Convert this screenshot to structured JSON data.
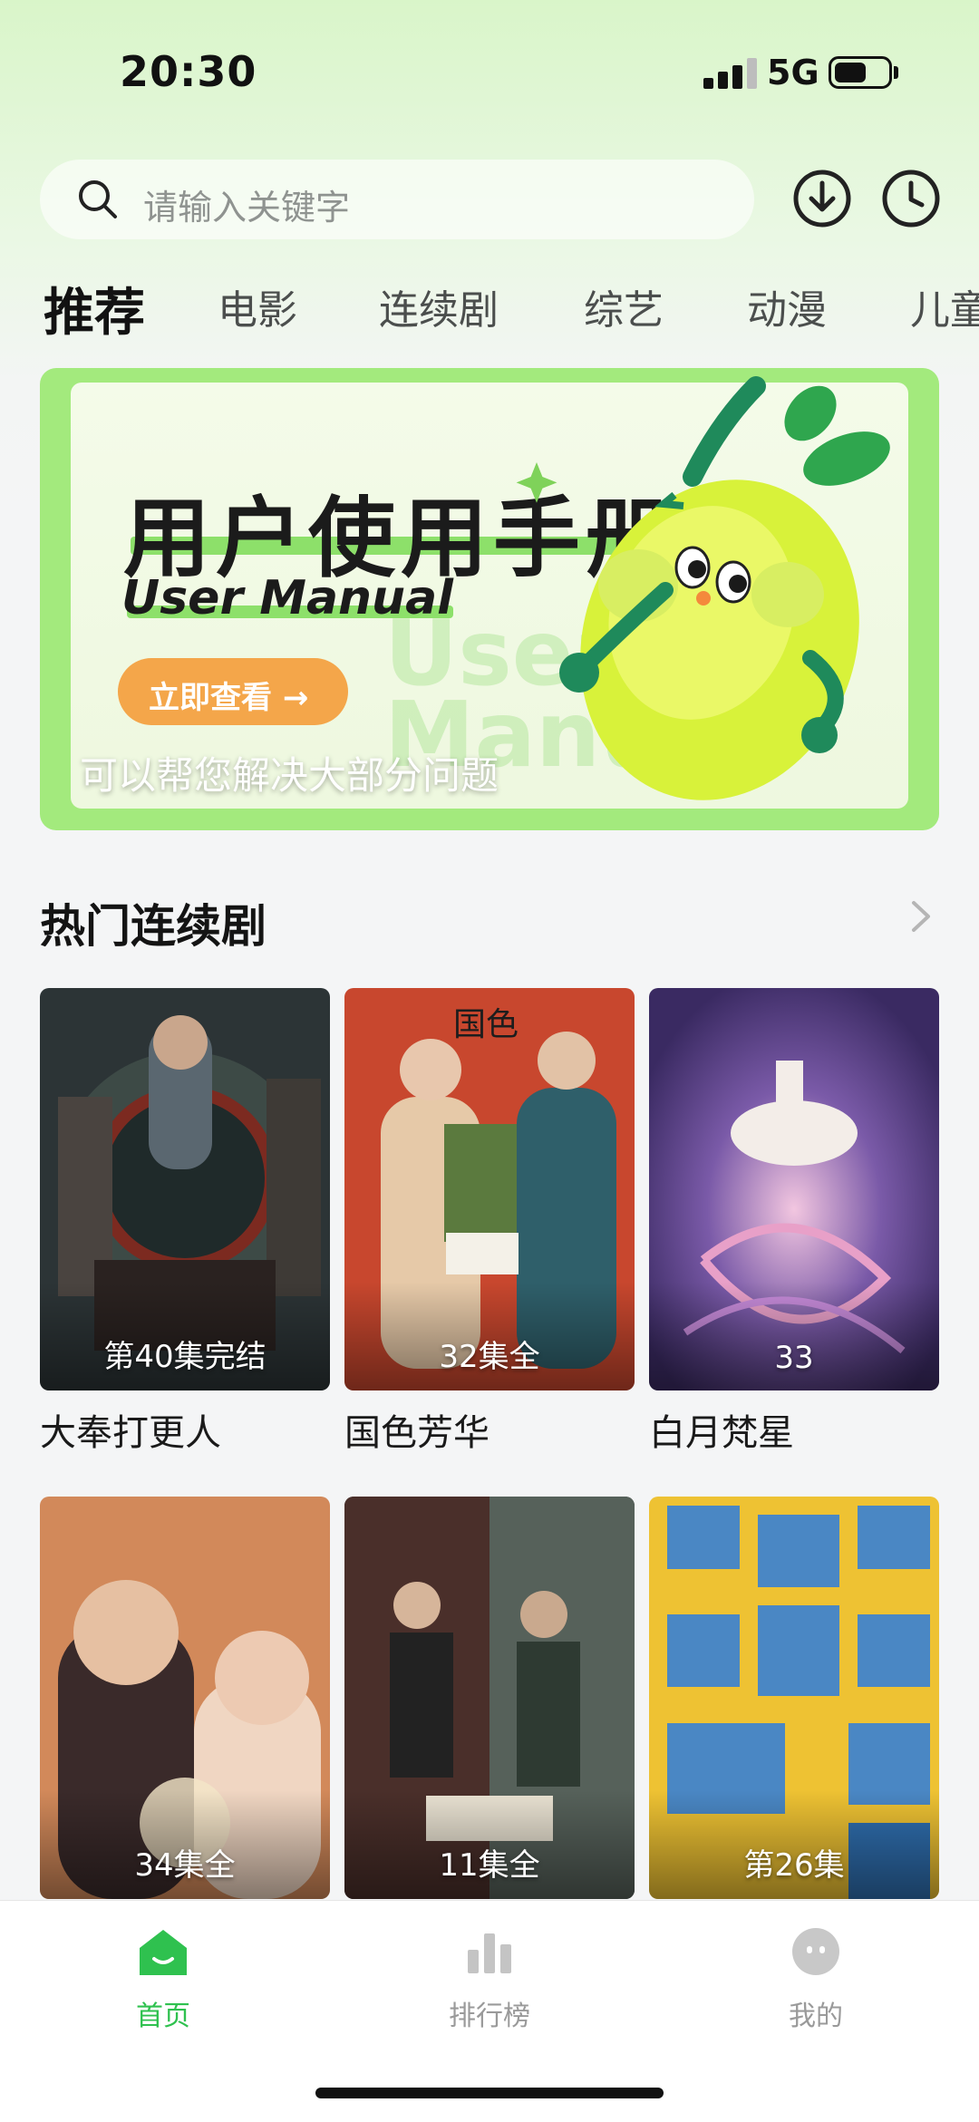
{
  "status_bar": {
    "time": "20:30",
    "network": "5G"
  },
  "search": {
    "placeholder": "请输入关键字"
  },
  "header_icons": {
    "download": "download-icon",
    "history": "history-clock-icon"
  },
  "tabs": [
    {
      "label": "推荐",
      "active": true
    },
    {
      "label": "电影"
    },
    {
      "label": "连续剧"
    },
    {
      "label": "综艺"
    },
    {
      "label": "动漫"
    },
    {
      "label": "儿童"
    }
  ],
  "banner": {
    "title": "用户使用手册",
    "subtitle": "User Manual",
    "watermark": "User Manual",
    "button_label": "立即查看 →",
    "caption": "可以帮您解决大部分问题"
  },
  "section": {
    "title": "热门连续剧"
  },
  "cards": [
    {
      "title": "大奉打更人",
      "badge": "第40集完结"
    },
    {
      "title": "国色芳华",
      "badge": "32集全"
    },
    {
      "title": "白月梵星",
      "badge": "33"
    },
    {
      "title": "",
      "badge": "34集全"
    },
    {
      "title": "",
      "badge": "11集全"
    },
    {
      "title": "",
      "badge": "第26集"
    }
  ],
  "bottom_nav": [
    {
      "label": "首页",
      "icon": "home-icon",
      "active": true
    },
    {
      "label": "排行榜",
      "icon": "ranking-chart-icon"
    },
    {
      "label": "我的",
      "icon": "profile-face-icon"
    }
  ],
  "colors": {
    "accent": "#2fc14f",
    "banner_frame": "#a3ea7d",
    "banner_button": "#f4a64a"
  }
}
